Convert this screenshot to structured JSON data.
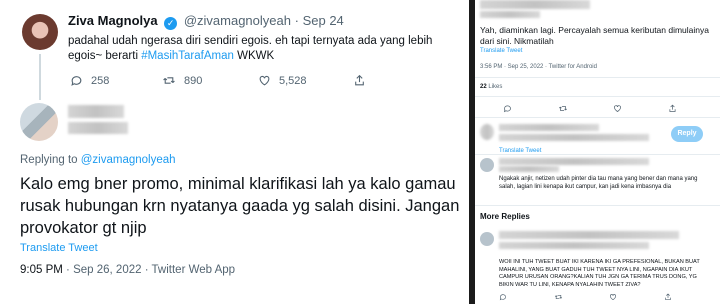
{
  "left_tweet": {
    "author_name": "Ziva Magnolya",
    "handle": "@zivamagnolyeah",
    "separator": "·",
    "date": "Sep 24",
    "text_main": "padahal udah ngerasa diri sendiri egois. eh tapi ternyata ada yang lebih egois~ berarti ",
    "hashtag": "#MasihTarafAman",
    "text_tail": " WKWK",
    "replies": "258",
    "retweets": "890",
    "likes": "5,528"
  },
  "reply_tweet": {
    "replying_prefix": "Replying to ",
    "replying_to": "@zivamagnolyeah",
    "text": "Kalo emg bner promo, minimal klarifikasi lah ya kalo gamau rusak hubungan krn nyatanya gaada yg salah disini. Jangan provokator gt njip",
    "translate_label": "Translate Tweet",
    "time": "9:05 PM",
    "dot": "·",
    "date": "Sep 26, 2022",
    "client": "Twitter Web App"
  },
  "right_panel": {
    "tweet_text": "Yah, diaminkan lagi. Percayalah semua keributan dimulainya dari sini. Nikmatilah",
    "translate_label": "Translate Tweet",
    "meta": "3:56 PM · Sep 25, 2022 · Twitter for Android",
    "likes_count": "22",
    "likes_label": "Likes",
    "reply_button": "Reply",
    "reply2_translate": "Translate Tweet",
    "reply2_text": "Ngakak anjir, netizen udah pinter dia tau mana yang bener dan mana yang salah, lagian lini kenapa ikut campur, kan jadi kena imbasnya dia",
    "more_replies": "More Replies",
    "reply3_text": "WOII INI TUH TWEET BUAT IKI KARENA IKI GA PREFESIONAL, BUKAN BUAT MAHALINI, YANG BUAT GADUH TUH TWEET NYA LINI, NGAPAIN DIA IKUT CAMPUR URUSAN ORANG?KALIAN TUH JGN GA TERIMA TRUS DONG, YG BIKIN WAR TU LINI, KENAPA NYALAHIN TWEET ZIVA?"
  },
  "icons": {
    "reply": "reply-icon",
    "retweet": "retweet-icon",
    "like": "heart-icon",
    "share": "share-icon",
    "verified": "verified-badge-icon"
  },
  "colors": {
    "accent": "#1d9bf0",
    "muted": "#536471",
    "text": "#0f1419"
  }
}
